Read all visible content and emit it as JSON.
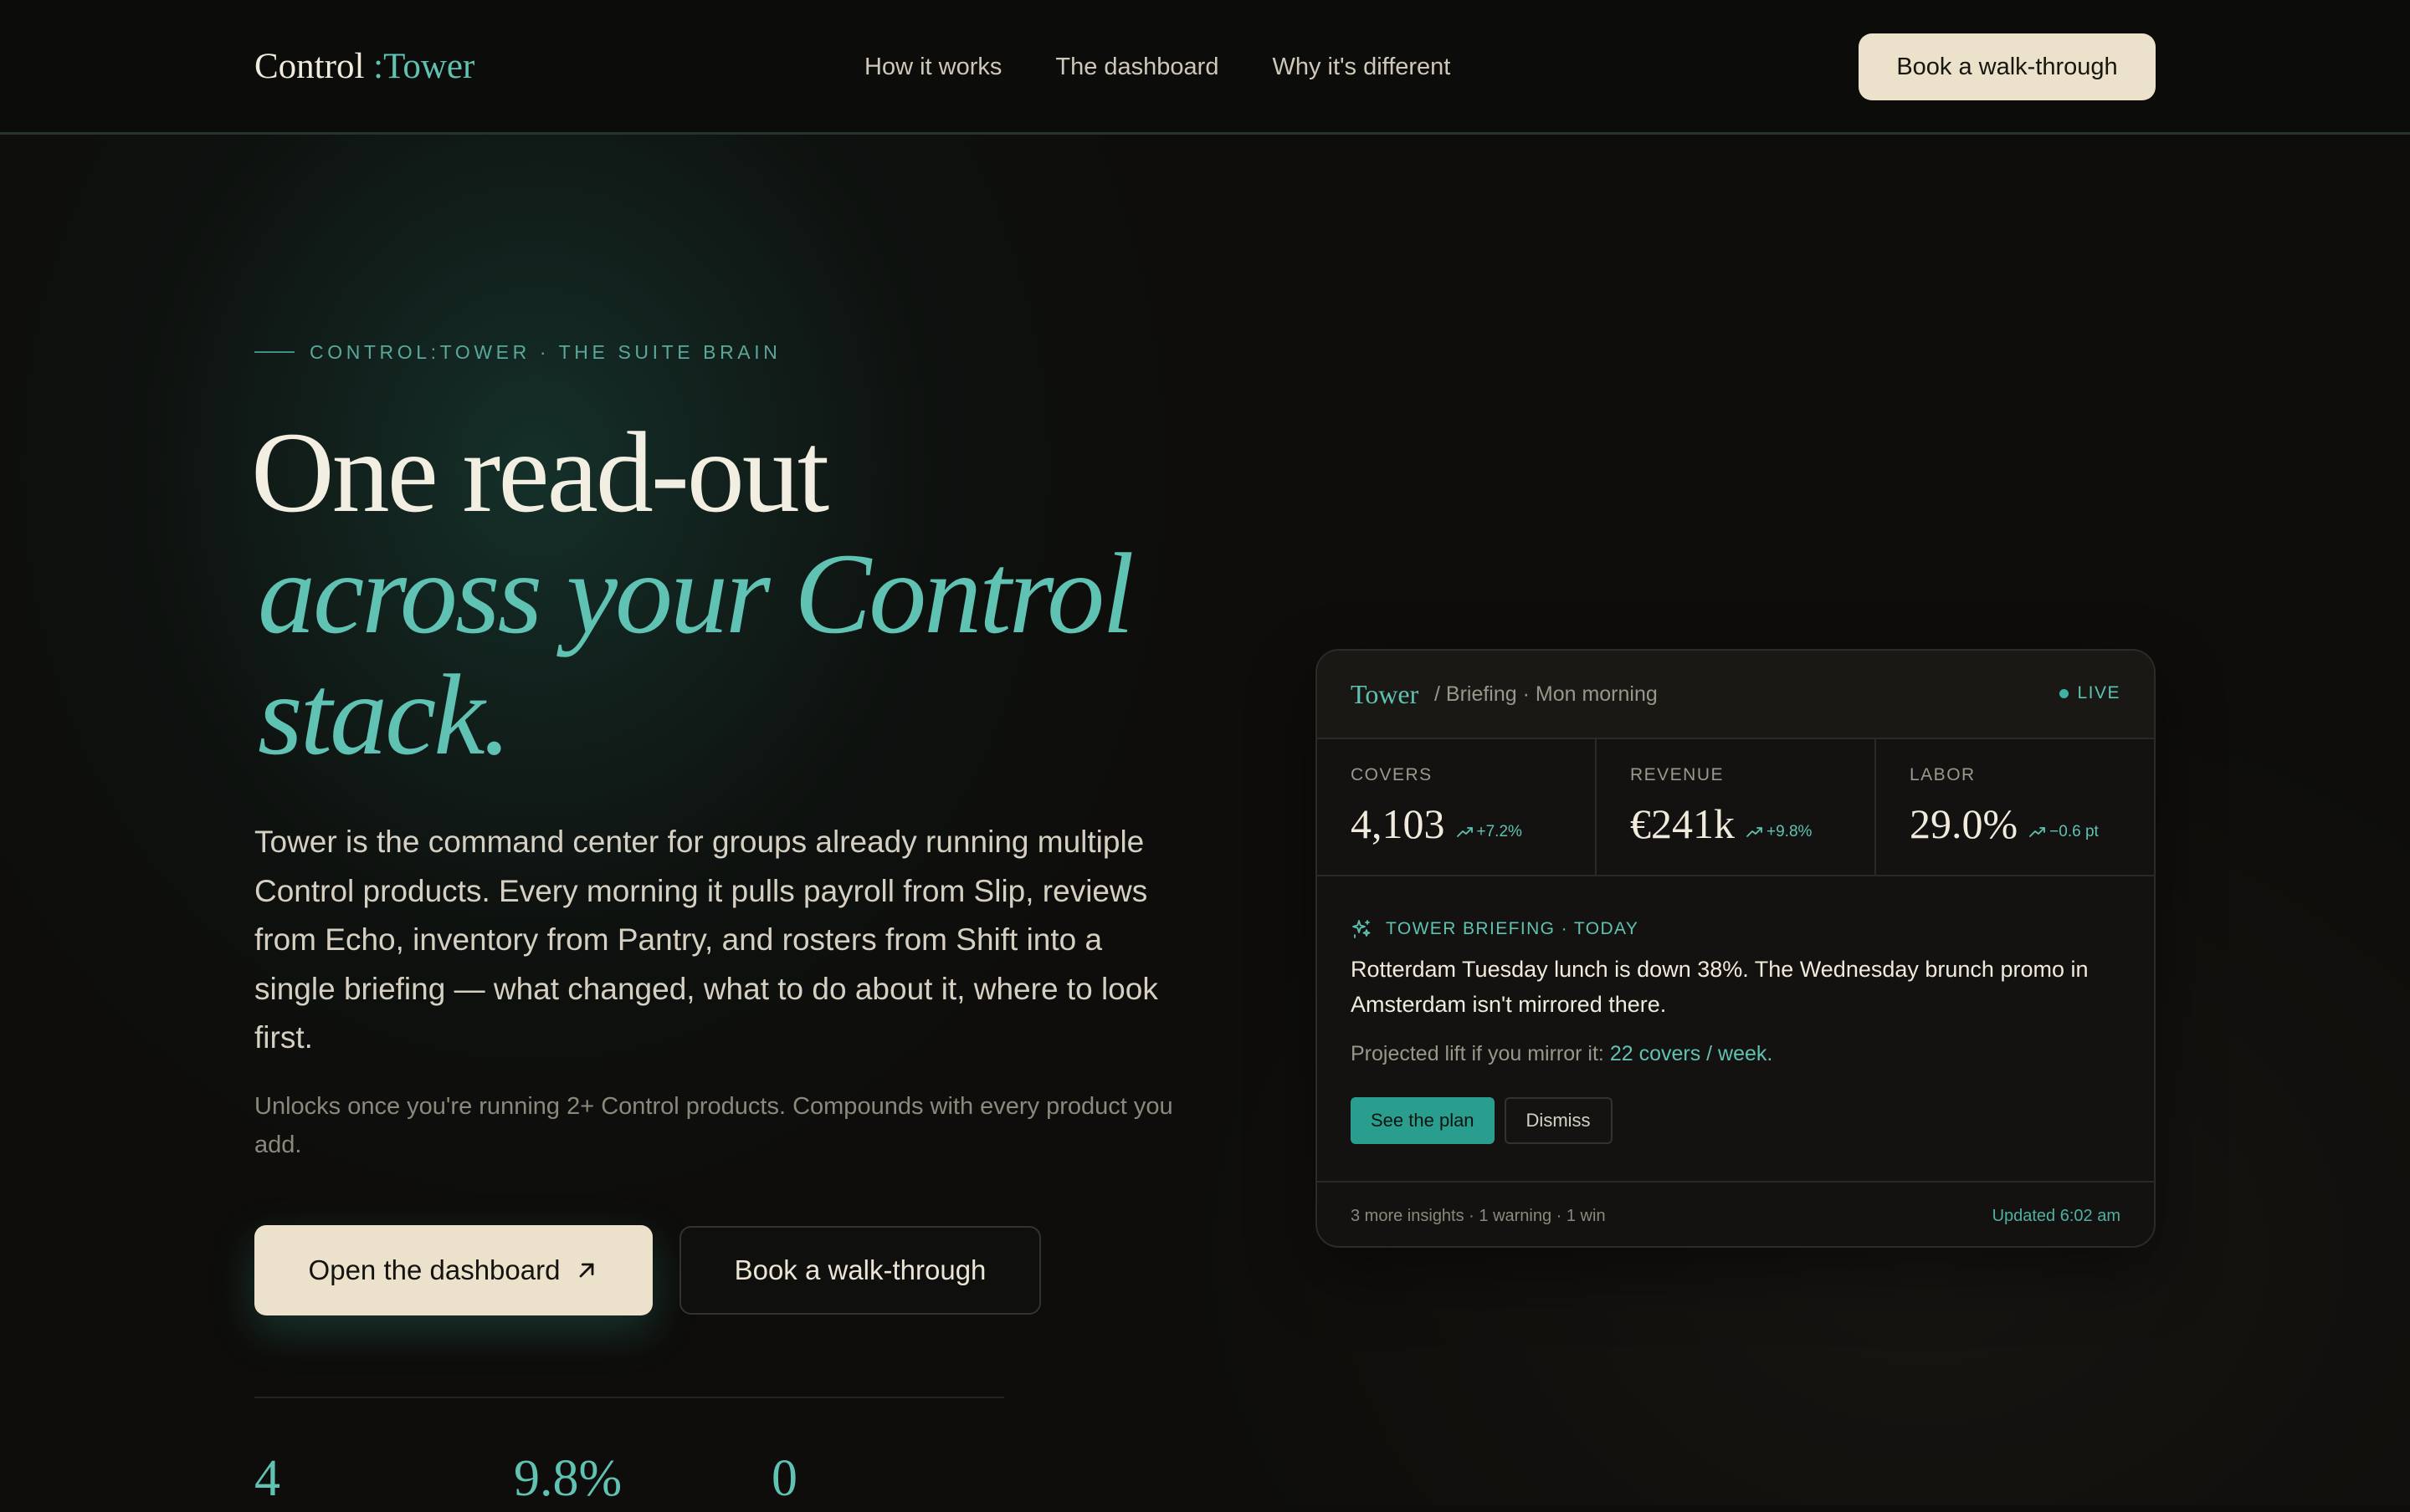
{
  "nav": {
    "logo_main": "Control ",
    "logo_accent": ":Tower",
    "links": [
      "How it works",
      "The dashboard",
      "Why it's different"
    ],
    "cta": "Book a walk-through"
  },
  "hero": {
    "eyebrow": "CONTROL:TOWER · THE SUITE BRAIN",
    "headline_line1": "One read-out",
    "headline_line2": "across your Control",
    "headline_line3": "stack.",
    "lead": "Tower is the command center for groups already running multiple Control products. Every morning it pulls payroll from Slip, reviews from Echo, inventory from Pantry, and rosters from Shift into a single briefing — what changed, what to do about it, where to look first.",
    "note": "Unlocks once you're running 2+ Control products. Compounds with every product you add.",
    "primary_cta": "Open the dashboard",
    "secondary_cta": "Book a walk-through",
    "stats": [
      "4",
      "9.8%",
      "0"
    ]
  },
  "card": {
    "brand": "Tower",
    "crumb": "/ Briefing · Mon morning",
    "live": "LIVE",
    "metrics": [
      {
        "label": "COVERS",
        "value": "4,103",
        "delta": "+7.2%"
      },
      {
        "label": "REVENUE",
        "value": "€241k",
        "delta": "+9.8%"
      },
      {
        "label": "LABOR",
        "value": "29.0%",
        "delta": "−0.6 pt"
      }
    ],
    "briefing": {
      "tag": "TOWER BRIEFING · TODAY",
      "text": "Rotterdam Tuesday lunch is down 38%. The Wednesday brunch promo in Amsterdam isn't mirrored there.",
      "lift_prefix": "Projected lift if you mirror it: ",
      "lift_value": "22 covers / week.",
      "primary": "See the plan",
      "secondary": "Dismiss"
    },
    "footer_left": "3 more insights · 1 warning · 1 win",
    "footer_right": "Updated 6:02 am"
  },
  "colors": {
    "accent": "#5fc2b3",
    "cream": "#ece1cb",
    "background": "#0e0d0b"
  }
}
